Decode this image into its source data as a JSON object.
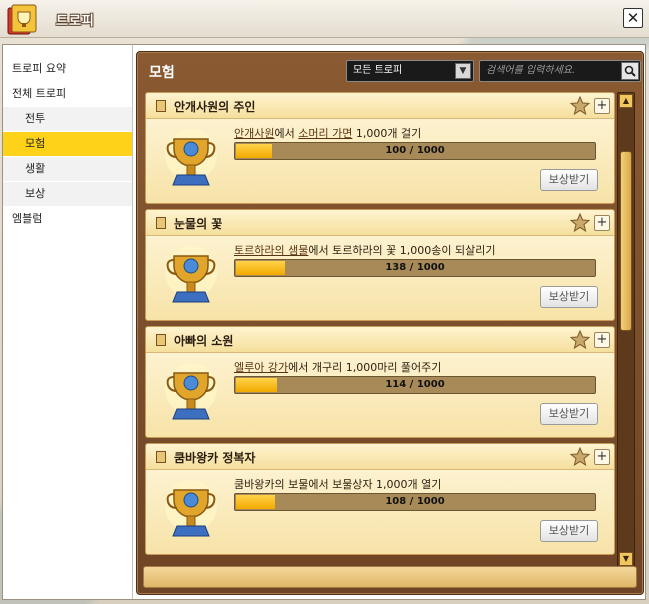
{
  "window": {
    "title": "트로피",
    "close_label": "✕"
  },
  "sidebar": {
    "items": [
      {
        "label": "트로피 요약"
      },
      {
        "label": "전체 트로피"
      },
      {
        "label": "전투"
      },
      {
        "label": "모험"
      },
      {
        "label": "생활"
      },
      {
        "label": "보상"
      },
      {
        "label": "엠블럼"
      }
    ]
  },
  "main": {
    "title": "모험",
    "filter": {
      "selected": "모든 트로피"
    },
    "search": {
      "placeholder": "검색어를 입력하세요."
    }
  },
  "cards": [
    {
      "title": "안개사원의 주인",
      "desc_parts": [
        "안개사원",
        "에서 ",
        "소머리 가면",
        " 1,000개 걸기"
      ],
      "progress_text": "100 / 1000",
      "progress_value": 0.1,
      "reward_label": "보상받기"
    },
    {
      "title": "눈물의 꽃",
      "desc_parts": [
        "토르하라의 샘물",
        "에서 토르하라의 꽃 1,000송이 되살리기"
      ],
      "progress_text": "138 / 1000",
      "progress_value": 0.138,
      "reward_label": "보상받기"
    },
    {
      "title": "아빠의 소원",
      "desc_parts": [
        "엘루아 강가",
        "에서 개구리 1,000마리 풀어주기"
      ],
      "progress_text": "114 / 1000",
      "progress_value": 0.114,
      "reward_label": "보상받기"
    },
    {
      "title": "쿰바왕카 정복자",
      "desc_parts": [
        "쿰바왕카의 보물에서 보물상자 1,000개 열기"
      ],
      "progress_text": "108 / 1000",
      "progress_value": 0.108,
      "reward_label": "보상받기"
    }
  ],
  "icons": {
    "close": "close-icon",
    "star": "star-icon",
    "plus": "plus-icon",
    "trophy": "trophy-icon",
    "search": "search-icon",
    "dropdown": "chevron-down-icon"
  },
  "colors": {
    "active_sidebar": "#ffd21a",
    "panel_brown": "#7a4c28",
    "card_bg": "#fbeec0",
    "progress_fill": "#f6b800"
  }
}
